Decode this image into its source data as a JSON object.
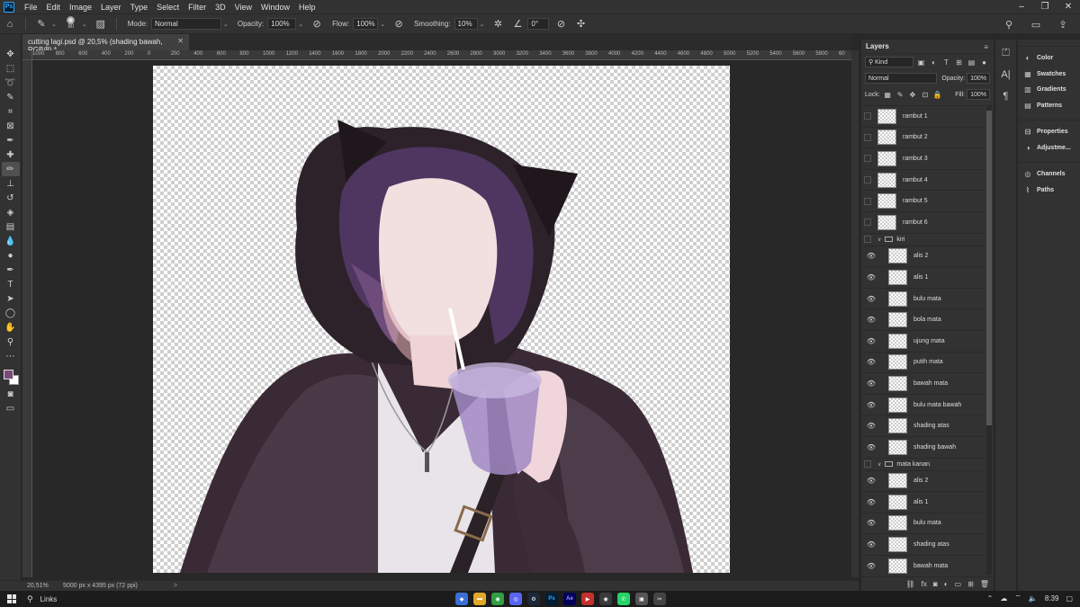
{
  "app": {
    "logo": "Ps"
  },
  "menu": [
    "File",
    "Edit",
    "Image",
    "Layer",
    "Type",
    "Select",
    "Filter",
    "3D",
    "View",
    "Window",
    "Help"
  ],
  "options": {
    "brush_size": "80",
    "mode_label": "Mode:",
    "mode_value": "Normal",
    "opacity_label": "Opacity:",
    "opacity_value": "100%",
    "flow_label": "Flow:",
    "flow_value": "100%",
    "smoothing_label": "Smoothing:",
    "smoothing_value": "10%",
    "angle_value": "0°"
  },
  "document": {
    "tab_title": "cutting lagi.psd @ 20,5% (shading bawah, RGB/8) *",
    "ruler_ticks": [
      "1000",
      "800",
      "600",
      "400",
      "200",
      "0",
      "200",
      "400",
      "600",
      "800",
      "1000",
      "1200",
      "1400",
      "1600",
      "1800",
      "2000",
      "2200",
      "2400",
      "2600",
      "2800",
      "3000",
      "3200",
      "3400",
      "3600",
      "3800",
      "4000",
      "4200",
      "4400",
      "4600",
      "4800",
      "5000",
      "5200",
      "5400",
      "5600",
      "5800",
      "60"
    ]
  },
  "status": {
    "zoom": "20,51%",
    "dimensions": "5000 px x 4395 px (72 ppi)",
    "arrow": ">"
  },
  "layers_panel": {
    "title": "Layers",
    "kind_label": "Kind",
    "blend_mode": "Normal",
    "opacity_label": "Opacity:",
    "opacity_value": "100%",
    "lock_label": "Lock:",
    "fill_label": "Fill:",
    "fill_value": "100%",
    "layers": [
      {
        "name": "rambut 1",
        "type": "layer",
        "visible": false,
        "indent": false
      },
      {
        "name": "rambut 2",
        "type": "layer",
        "visible": false,
        "indent": false
      },
      {
        "name": "rambut 3",
        "type": "layer",
        "visible": false,
        "indent": false
      },
      {
        "name": "rambut 4",
        "type": "layer",
        "visible": false,
        "indent": false
      },
      {
        "name": "rambut 5",
        "type": "layer",
        "visible": false,
        "indent": false
      },
      {
        "name": "rambut 6",
        "type": "layer",
        "visible": false,
        "indent": false
      },
      {
        "name": "kiri",
        "type": "group",
        "visible": false,
        "indent": false
      },
      {
        "name": "alis 2",
        "type": "layer",
        "visible": true,
        "indent": true
      },
      {
        "name": "alis 1",
        "type": "layer",
        "visible": true,
        "indent": true
      },
      {
        "name": "bulu mata",
        "type": "layer",
        "visible": true,
        "indent": true
      },
      {
        "name": "bola mata",
        "type": "layer",
        "visible": true,
        "indent": true
      },
      {
        "name": "ujung mata",
        "type": "layer",
        "visible": true,
        "indent": true
      },
      {
        "name": "putih mata",
        "type": "layer",
        "visible": true,
        "indent": true
      },
      {
        "name": "bawah mata",
        "type": "layer",
        "visible": true,
        "indent": true
      },
      {
        "name": "bulu mata bawah",
        "type": "layer",
        "visible": true,
        "indent": true
      },
      {
        "name": "shading atas",
        "type": "layer",
        "visible": true,
        "indent": true
      },
      {
        "name": "shading bawah",
        "type": "layer",
        "visible": true,
        "indent": true
      },
      {
        "name": "mata kanan",
        "type": "group",
        "visible": false,
        "indent": false
      },
      {
        "name": "alis 2",
        "type": "layer",
        "visible": true,
        "indent": true
      },
      {
        "name": "alis 1",
        "type": "layer",
        "visible": true,
        "indent": true
      },
      {
        "name": "bulu mata",
        "type": "layer",
        "visible": true,
        "indent": true
      },
      {
        "name": "shading atas",
        "type": "layer",
        "visible": true,
        "indent": true
      },
      {
        "name": "bawah mata",
        "type": "layer",
        "visible": true,
        "indent": true
      }
    ]
  },
  "dock": {
    "group1": [
      "Color",
      "Swatches",
      "Gradients",
      "Patterns"
    ],
    "group2": [
      "Properties",
      "Adjustme..."
    ],
    "group3": [
      "Channels",
      "Paths"
    ]
  },
  "taskbar": {
    "search_label": "Links",
    "time": "8:39"
  },
  "colors": {
    "foreground": "#7a4a78",
    "background": "#ffffff",
    "ps_accent": "#31a8ff"
  }
}
